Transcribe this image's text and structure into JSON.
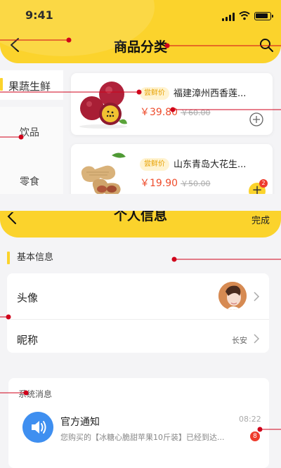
{
  "status_bar": {
    "time": "9:41"
  },
  "category_page": {
    "title": "商品分类",
    "categories": [
      {
        "label": "果蔬生鲜",
        "active": true
      },
      {
        "label": "饮品",
        "active": false
      },
      {
        "label": "零食",
        "active": false
      }
    ],
    "products": [
      {
        "tag": "尝鲜价",
        "name": "福建漳州西香莲...",
        "price": "￥39.80",
        "original_price": "￥60.00",
        "image": "passion-fruit"
      },
      {
        "tag": "尝鲜价",
        "name": "山东青岛大花生...",
        "price": "￥19.90",
        "original_price": "￥50.00",
        "image": "peanuts",
        "cart_count": "2"
      }
    ]
  },
  "profile_page": {
    "title": "个人信息",
    "done_label": "完成",
    "section_title": "基本信息",
    "rows": [
      {
        "label": "头像"
      },
      {
        "label": "昵称",
        "value": "长安"
      }
    ]
  },
  "message_page": {
    "heading": "系统消息",
    "items": [
      {
        "title": "官方通知",
        "time": "08:22",
        "preview": "您购买的【冰糖心脆甜苹果10斤装】已经到达...",
        "unread": "8",
        "icon": "speaker-icon"
      }
    ]
  },
  "colors": {
    "accent": "#fbd32c",
    "price": "#ee4c2c",
    "notice_icon": "#3f8ff0",
    "annotation": "#d0021b"
  }
}
